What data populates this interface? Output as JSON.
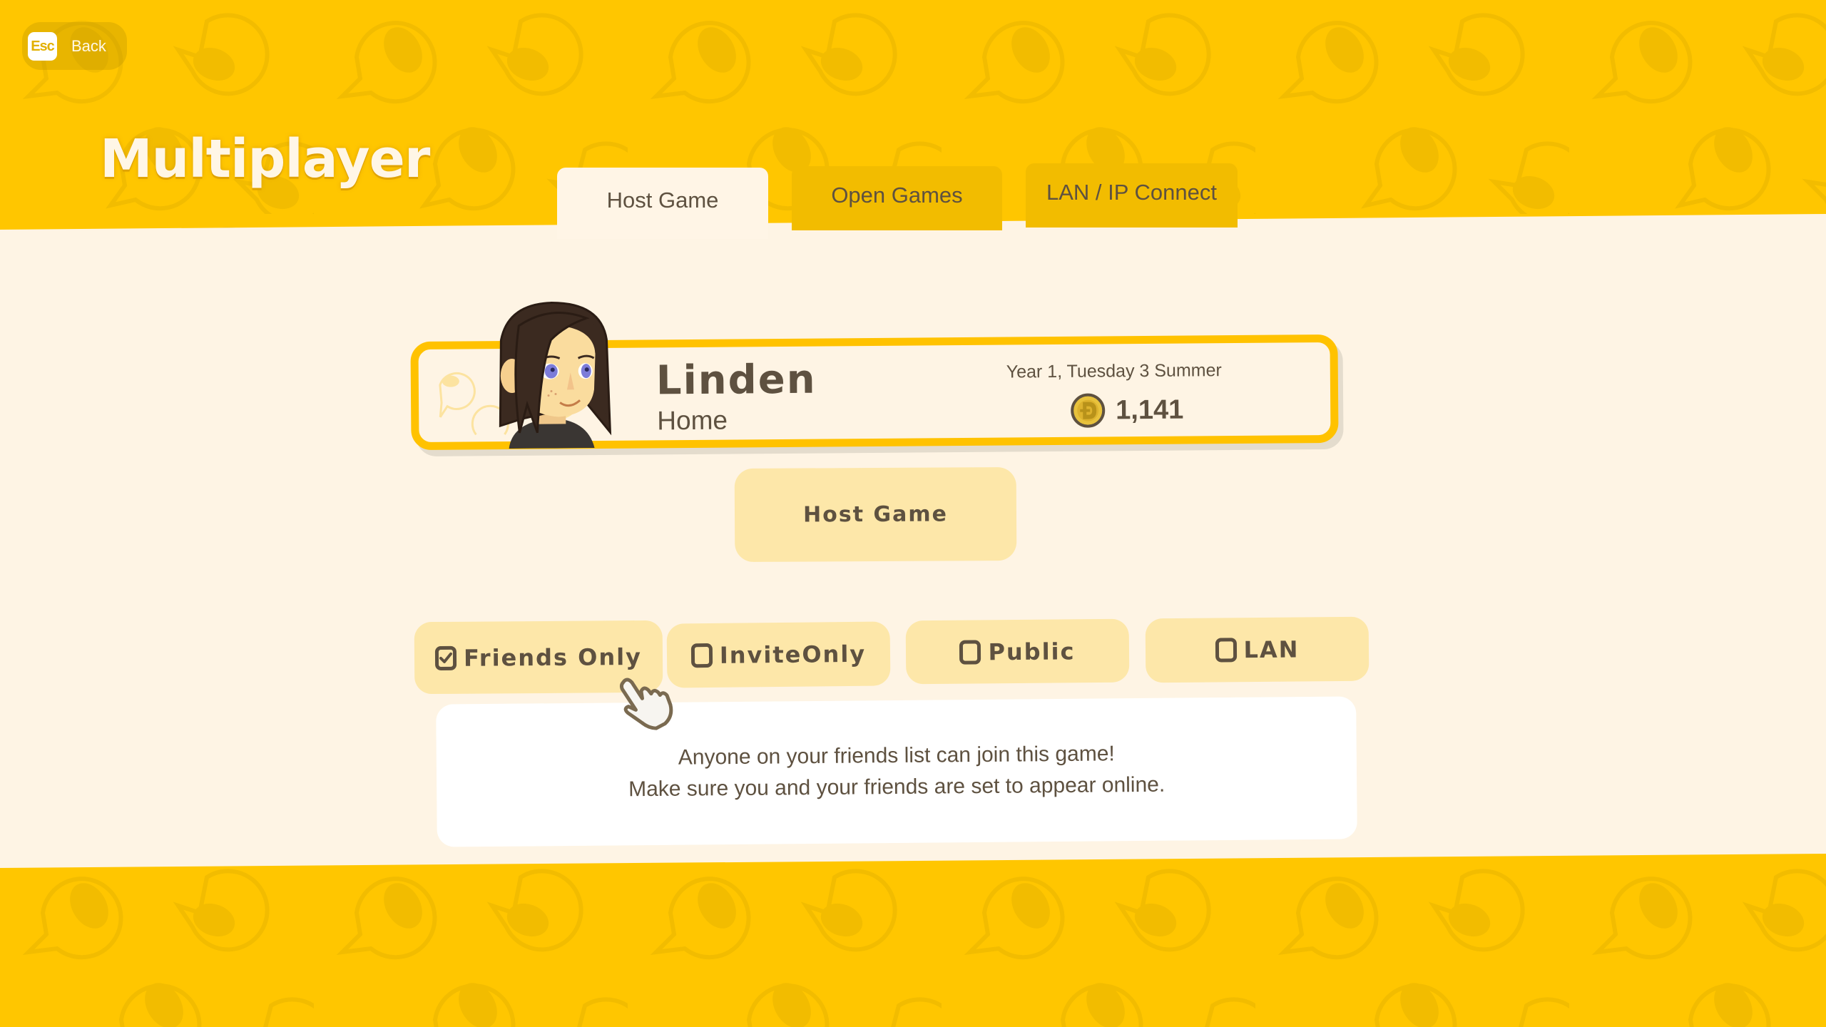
{
  "back_button": {
    "key_label": "Esc",
    "label": "Back"
  },
  "page_title": "Multiplayer",
  "tabs": [
    {
      "label": "Host Game",
      "active": true
    },
    {
      "label": "Open Games",
      "active": false
    },
    {
      "label": "LAN / IP Connect",
      "active": false
    }
  ],
  "profile": {
    "name": "Linden",
    "location": "Home",
    "save_date": "Year 1, Tuesday 3 Summer",
    "money": "1,141",
    "money_icon": "coin-icon"
  },
  "host_button_label": "Host Game",
  "privacy_options": [
    {
      "label": "Friends Only",
      "checked": true
    },
    {
      "label": "InviteOnly",
      "checked": false
    },
    {
      "label": "Public",
      "checked": false
    },
    {
      "label": "LAN",
      "checked": false
    }
  ],
  "description": {
    "line1": "Anyone on your friends list can join this game!",
    "line2": "Make sure you and your friends are set to appear online."
  },
  "colors": {
    "background": "#FFC600",
    "pattern": "#F2BC00",
    "panel": "#FEF4E4",
    "card_border": "#FFC200",
    "button": "#FDE7A9",
    "text": "#5E5140"
  }
}
